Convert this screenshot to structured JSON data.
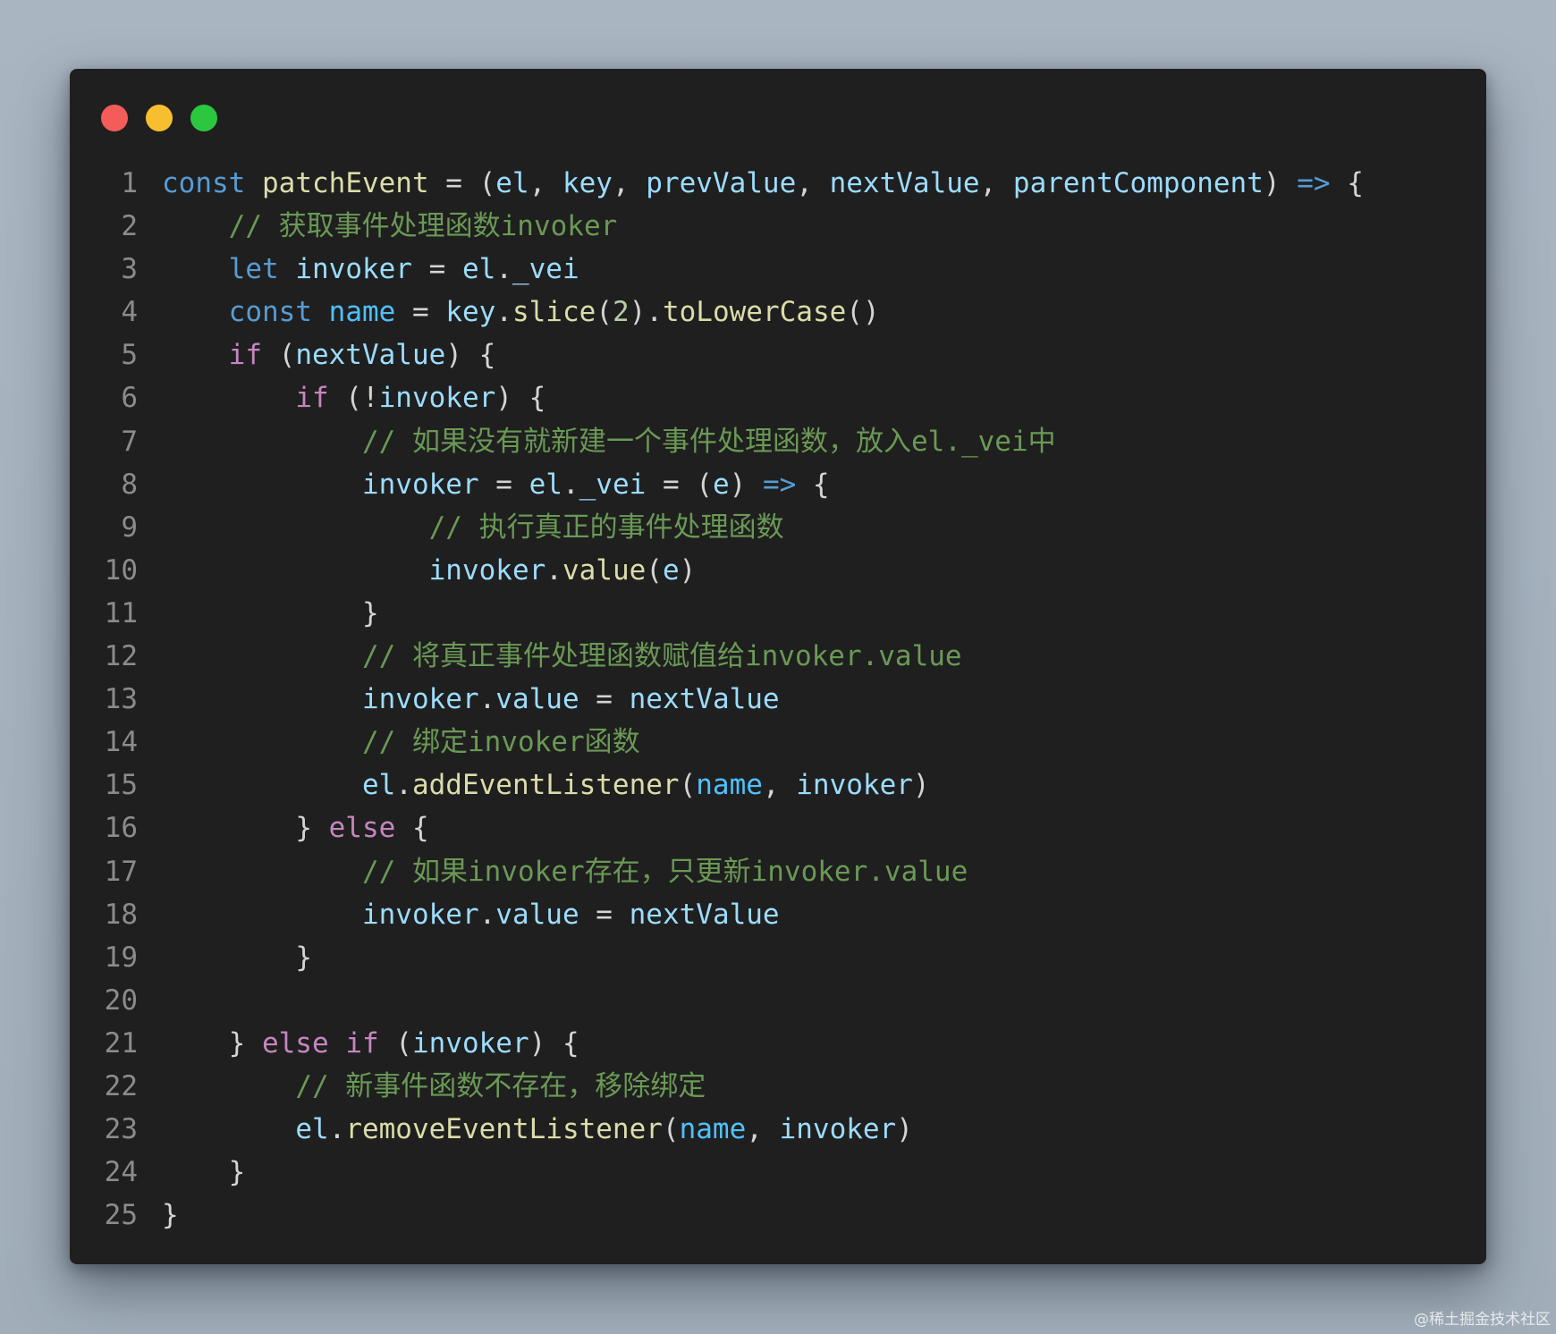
{
  "window": {
    "controls": {
      "close_color": "#f35c58",
      "minimize_color": "#f7be2f",
      "maximize_color": "#2bc73f"
    }
  },
  "code_lines": [
    {
      "n": "1",
      "indent": "",
      "tokens": [
        [
          "kw",
          "const"
        ],
        [
          "pn",
          " "
        ],
        [
          "fn",
          "patchEvent"
        ],
        [
          "pn",
          " = ("
        ],
        [
          "var",
          "el"
        ],
        [
          "pn",
          ", "
        ],
        [
          "var",
          "key"
        ],
        [
          "pn",
          ", "
        ],
        [
          "var",
          "prevValue"
        ],
        [
          "pn",
          ", "
        ],
        [
          "var",
          "nextValue"
        ],
        [
          "pn",
          ", "
        ],
        [
          "var",
          "parentComponent"
        ],
        [
          "pn",
          ") "
        ],
        [
          "kw",
          "=>"
        ],
        [
          "pn",
          " {"
        ]
      ]
    },
    {
      "n": "2",
      "indent": "    ",
      "tokens": [
        [
          "cm",
          "// 获取事件处理函数invoker"
        ]
      ]
    },
    {
      "n": "3",
      "indent": "    ",
      "tokens": [
        [
          "kw",
          "let"
        ],
        [
          "pn",
          " "
        ],
        [
          "var",
          "invoker"
        ],
        [
          "pn",
          " = "
        ],
        [
          "var",
          "el"
        ],
        [
          "pn",
          "."
        ],
        [
          "var",
          "_vei"
        ]
      ]
    },
    {
      "n": "4",
      "indent": "    ",
      "tokens": [
        [
          "kw",
          "const"
        ],
        [
          "pn",
          " "
        ],
        [
          "cst",
          "name"
        ],
        [
          "pn",
          " = "
        ],
        [
          "var",
          "key"
        ],
        [
          "pn",
          "."
        ],
        [
          "fn",
          "slice"
        ],
        [
          "pn",
          "("
        ],
        [
          "num",
          "2"
        ],
        [
          "pn",
          ")."
        ],
        [
          "fn",
          "toLowerCase"
        ],
        [
          "pn",
          "()"
        ]
      ]
    },
    {
      "n": "5",
      "indent": "    ",
      "tokens": [
        [
          "ctrl",
          "if"
        ],
        [
          "pn",
          " ("
        ],
        [
          "var",
          "nextValue"
        ],
        [
          "pn",
          ") {"
        ]
      ]
    },
    {
      "n": "6",
      "indent": "        ",
      "tokens": [
        [
          "ctrl",
          "if"
        ],
        [
          "pn",
          " (!"
        ],
        [
          "var",
          "invoker"
        ],
        [
          "pn",
          ") {"
        ]
      ]
    },
    {
      "n": "7",
      "indent": "            ",
      "tokens": [
        [
          "cm",
          "// 如果没有就新建一个事件处理函数，放入el._vei中"
        ]
      ]
    },
    {
      "n": "8",
      "indent": "            ",
      "tokens": [
        [
          "var",
          "invoker"
        ],
        [
          "pn",
          " = "
        ],
        [
          "var",
          "el"
        ],
        [
          "pn",
          "."
        ],
        [
          "var",
          "_vei"
        ],
        [
          "pn",
          " = ("
        ],
        [
          "var",
          "e"
        ],
        [
          "pn",
          ") "
        ],
        [
          "kw",
          "=>"
        ],
        [
          "pn",
          " {"
        ]
      ]
    },
    {
      "n": "9",
      "indent": "                ",
      "tokens": [
        [
          "cm",
          "// 执行真正的事件处理函数"
        ]
      ]
    },
    {
      "n": "10",
      "indent": "                ",
      "tokens": [
        [
          "var",
          "invoker"
        ],
        [
          "pn",
          "."
        ],
        [
          "fn",
          "value"
        ],
        [
          "pn",
          "("
        ],
        [
          "var",
          "e"
        ],
        [
          "pn",
          ")"
        ]
      ]
    },
    {
      "n": "11",
      "indent": "            ",
      "tokens": [
        [
          "pn",
          "}"
        ]
      ]
    },
    {
      "n": "12",
      "indent": "            ",
      "tokens": [
        [
          "cm",
          "// 将真正事件处理函数赋值给invoker.value"
        ]
      ]
    },
    {
      "n": "13",
      "indent": "            ",
      "tokens": [
        [
          "var",
          "invoker"
        ],
        [
          "pn",
          "."
        ],
        [
          "var",
          "value"
        ],
        [
          "pn",
          " = "
        ],
        [
          "var",
          "nextValue"
        ]
      ]
    },
    {
      "n": "14",
      "indent": "            ",
      "tokens": [
        [
          "cm",
          "// 绑定invoker函数"
        ]
      ]
    },
    {
      "n": "15",
      "indent": "            ",
      "tokens": [
        [
          "var",
          "el"
        ],
        [
          "pn",
          "."
        ],
        [
          "fn",
          "addEventListener"
        ],
        [
          "pn",
          "("
        ],
        [
          "cst",
          "name"
        ],
        [
          "pn",
          ", "
        ],
        [
          "var",
          "invoker"
        ],
        [
          "pn",
          ")"
        ]
      ]
    },
    {
      "n": "16",
      "indent": "        ",
      "tokens": [
        [
          "pn",
          "} "
        ],
        [
          "ctrl",
          "else"
        ],
        [
          "pn",
          " {"
        ]
      ]
    },
    {
      "n": "17",
      "indent": "            ",
      "tokens": [
        [
          "cm",
          "// 如果invoker存在，只更新invoker.value"
        ]
      ]
    },
    {
      "n": "18",
      "indent": "            ",
      "tokens": [
        [
          "var",
          "invoker"
        ],
        [
          "pn",
          "."
        ],
        [
          "var",
          "value"
        ],
        [
          "pn",
          " = "
        ],
        [
          "var",
          "nextValue"
        ]
      ]
    },
    {
      "n": "19",
      "indent": "        ",
      "tokens": [
        [
          "pn",
          "}"
        ]
      ]
    },
    {
      "n": "20",
      "indent": "",
      "tokens": []
    },
    {
      "n": "21",
      "indent": "    ",
      "tokens": [
        [
          "pn",
          "} "
        ],
        [
          "ctrl",
          "else"
        ],
        [
          "pn",
          " "
        ],
        [
          "ctrl",
          "if"
        ],
        [
          "pn",
          " ("
        ],
        [
          "var",
          "invoker"
        ],
        [
          "pn",
          ") {"
        ]
      ]
    },
    {
      "n": "22",
      "indent": "        ",
      "tokens": [
        [
          "cm",
          "// 新事件函数不存在，移除绑定"
        ]
      ]
    },
    {
      "n": "23",
      "indent": "        ",
      "tokens": [
        [
          "var",
          "el"
        ],
        [
          "pn",
          "."
        ],
        [
          "fn",
          "removeEventListener"
        ],
        [
          "pn",
          "("
        ],
        [
          "cst",
          "name"
        ],
        [
          "pn",
          ", "
        ],
        [
          "var",
          "invoker"
        ],
        [
          "pn",
          ")"
        ]
      ]
    },
    {
      "n": "24",
      "indent": "    ",
      "tokens": [
        [
          "pn",
          "}"
        ]
      ]
    },
    {
      "n": "25",
      "indent": "",
      "tokens": [
        [
          "pn",
          "}"
        ]
      ]
    }
  ],
  "watermark": "@稀土掘金技术社区"
}
